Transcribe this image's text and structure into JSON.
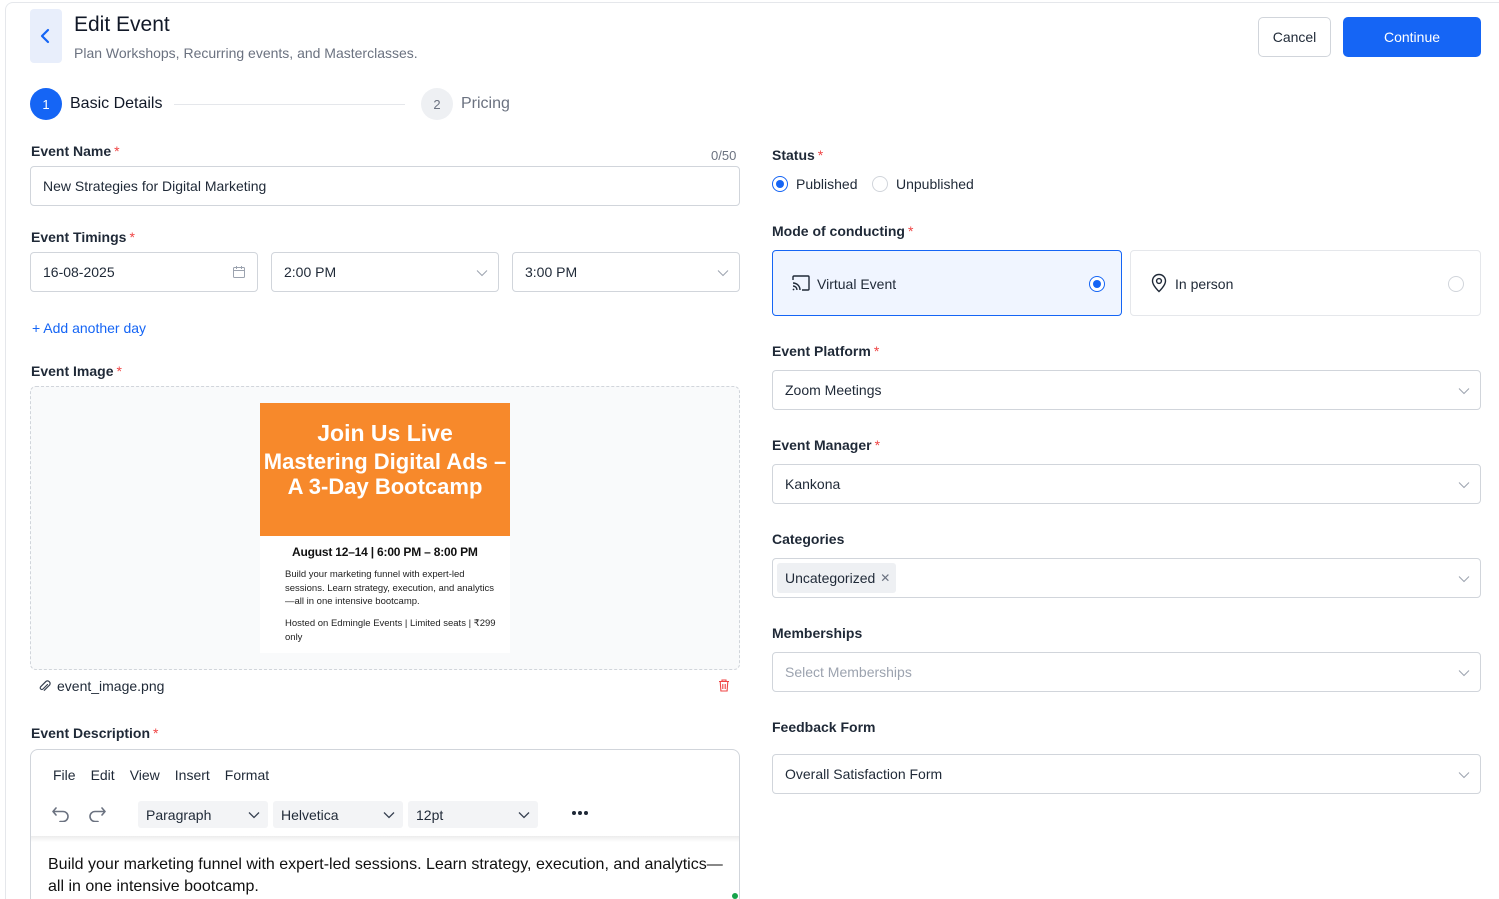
{
  "header": {
    "title": "Edit Event",
    "subtitle": "Plan Workshops, Recurring events, and Masterclasses.",
    "cancel_label": "Cancel",
    "continue_label": "Continue"
  },
  "steps": [
    {
      "number": "1",
      "label": "Basic Details",
      "active": true
    },
    {
      "number": "2",
      "label": "Pricing",
      "active": false
    }
  ],
  "event_name": {
    "label": "Event Name",
    "required": "*",
    "counter": "0/50",
    "value": "New Strategies for Digital Marketing"
  },
  "event_timings": {
    "label": "Event Timings",
    "required": "*",
    "date": "16-08-2025",
    "start_time": "2:00 PM",
    "end_time": "3:00 PM",
    "add_day_label": "+ Add another day"
  },
  "event_image": {
    "label": "Event Image",
    "required": "*",
    "file_name": "event_image.png",
    "poster": {
      "heading1": "Join Us Live",
      "heading2": "Mastering Digital Ads – A 3-Day Bootcamp",
      "date_line": "August 12–14 | 6:00 PM – 8:00 PM",
      "description": "Build your marketing funnel with expert-led sessions. Learn strategy, execution, and analytics—all in one intensive bootcamp.",
      "hosted": "Hosted on Edmingle Events | Limited seats | ₹299 only"
    }
  },
  "event_description": {
    "label": "Event Description",
    "required": "*",
    "menu": [
      "File",
      "Edit",
      "View",
      "Insert",
      "Format"
    ],
    "block_format": "Paragraph",
    "font_family": "Helvetica",
    "font_size": "12pt",
    "content": "Build your marketing funnel with expert-led sessions. Learn strategy, execution, and analytics—all in one intensive bootcamp."
  },
  "status": {
    "label": "Status",
    "required": "*",
    "options": [
      "Published",
      "Unpublished"
    ],
    "selected": "Published"
  },
  "mode": {
    "label": "Mode of conducting",
    "required": "*",
    "options": [
      "Virtual Event",
      "In person"
    ],
    "selected": "Virtual Event"
  },
  "platform": {
    "label": "Event Platform",
    "required": "*",
    "value": "Zoom Meetings"
  },
  "manager": {
    "label": "Event Manager",
    "required": "*",
    "value": "Kankona"
  },
  "categories": {
    "label": "Categories",
    "tags": [
      "Uncategorized"
    ]
  },
  "memberships": {
    "label": "Memberships",
    "placeholder": "Select Memberships"
  },
  "feedback": {
    "label": "Feedback Form",
    "value": "Overall Satisfaction Form"
  },
  "colors": {
    "primary": "#1565f5",
    "required": "#ef4444",
    "poster_orange": "#f7892b"
  }
}
